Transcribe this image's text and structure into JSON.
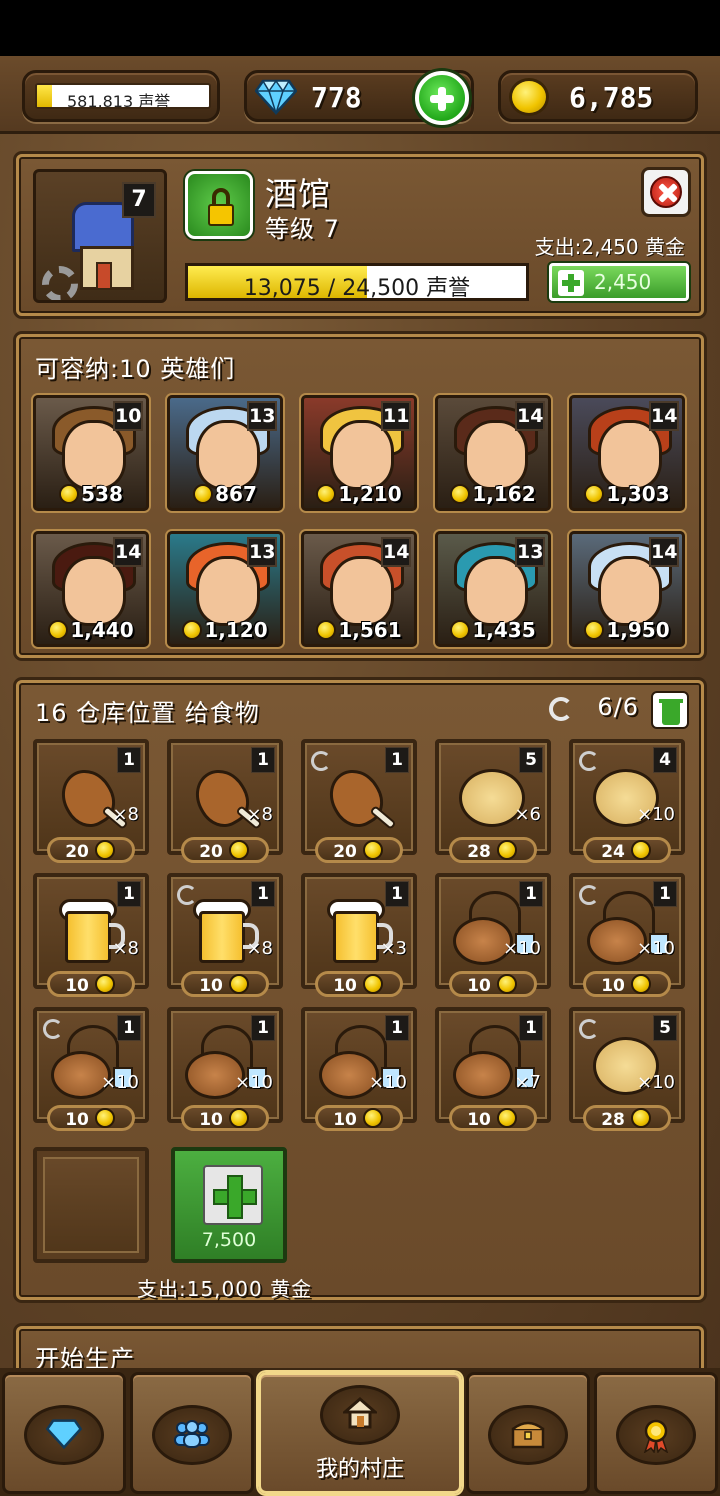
{
  "topbar": {
    "reputation": "581,813 声誉",
    "reputation_progress": 0.09,
    "gems": "778",
    "gold": "6,785"
  },
  "building": {
    "name": "酒馆",
    "level_text": "等级 7",
    "level_badge": "7",
    "upgrade_cost_text": "支出:2,450 黄金",
    "progress_text": "13,075 / 24,500 声誉",
    "progress_fraction": 0.53,
    "upgrade_button_amount": "2,450"
  },
  "heroes": {
    "caption": "可容纳:10 英雄们",
    "items": [
      {
        "level": "10",
        "price": "538",
        "hair": "#8a5a2a",
        "bg": "#6a5a4a"
      },
      {
        "level": "13",
        "price": "867",
        "hair": "#bcd8f0",
        "bg": "#4a6a8a"
      },
      {
        "level": "11",
        "price": "1,210",
        "hair": "#f0c440",
        "bg": "#8a3a2a"
      },
      {
        "level": "14",
        "price": "1,162",
        "hair": "#5a2a1a",
        "bg": "#5a4a3a"
      },
      {
        "level": "14",
        "price": "1,303",
        "hair": "#b8401a",
        "bg": "#4a4a5a"
      },
      {
        "level": "14",
        "price": "1,440",
        "hair": "#4a1a10",
        "bg": "#6a5a4a"
      },
      {
        "level": "13",
        "price": "1,120",
        "hair": "#e8642a",
        "bg": "#2a7a8a"
      },
      {
        "level": "14",
        "price": "1,561",
        "hair": "#c8502a",
        "bg": "#6a5a4a"
      },
      {
        "level": "13",
        "price": "1,435",
        "hair": "#2a9ab0",
        "bg": "#5a5a4a"
      },
      {
        "level": "14",
        "price": "1,950",
        "hair": "#c8e0f4",
        "bg": "#5a6a7a"
      }
    ]
  },
  "storage": {
    "caption": "16 仓库位置 给食物",
    "count": "6/6",
    "cost_text": "支出:15,000 黄金",
    "buy_slot_price": "7,500",
    "items": [
      {
        "kind": "drumstick",
        "count": "1",
        "qty": "×8",
        "price": "20",
        "refresh": false
      },
      {
        "kind": "drumstick",
        "count": "1",
        "qty": "×8",
        "price": "20",
        "refresh": false
      },
      {
        "kind": "drumstick",
        "count": "1",
        "qty": "",
        "price": "20",
        "refresh": true
      },
      {
        "kind": "biscuit",
        "count": "5",
        "qty": "×6",
        "price": "28",
        "refresh": false
      },
      {
        "kind": "biscuit",
        "count": "4",
        "qty": "×10",
        "price": "24",
        "refresh": true
      },
      {
        "kind": "beer",
        "count": "1",
        "qty": "×8",
        "price": "10",
        "refresh": false
      },
      {
        "kind": "beer",
        "count": "1",
        "qty": "×8",
        "price": "10",
        "refresh": true
      },
      {
        "kind": "beer",
        "count": "1",
        "qty": "×3",
        "price": "10",
        "refresh": false
      },
      {
        "kind": "flask",
        "count": "1",
        "qty": "×10",
        "price": "10",
        "refresh": false
      },
      {
        "kind": "flask",
        "count": "1",
        "qty": "×10",
        "price": "10",
        "refresh": true
      },
      {
        "kind": "flask",
        "count": "1",
        "qty": "×10",
        "price": "10",
        "refresh": true
      },
      {
        "kind": "flask",
        "count": "1",
        "qty": "×10",
        "price": "10",
        "refresh": false
      },
      {
        "kind": "flask",
        "count": "1",
        "qty": "×10",
        "price": "10",
        "refresh": false
      },
      {
        "kind": "flask",
        "count": "1",
        "qty": "×7",
        "price": "10",
        "refresh": false
      },
      {
        "kind": "biscuit",
        "count": "5",
        "qty": "×10",
        "price": "28",
        "refresh": true
      }
    ]
  },
  "production": {
    "caption": "开始生产"
  },
  "nav": {
    "items": [
      {
        "icon": "diamond-icon",
        "label": ""
      },
      {
        "icon": "people-icon",
        "label": ""
      },
      {
        "icon": "house-icon",
        "label": "我的村庄"
      },
      {
        "icon": "chest-icon",
        "label": ""
      },
      {
        "icon": "medal-icon",
        "label": ""
      }
    ]
  }
}
